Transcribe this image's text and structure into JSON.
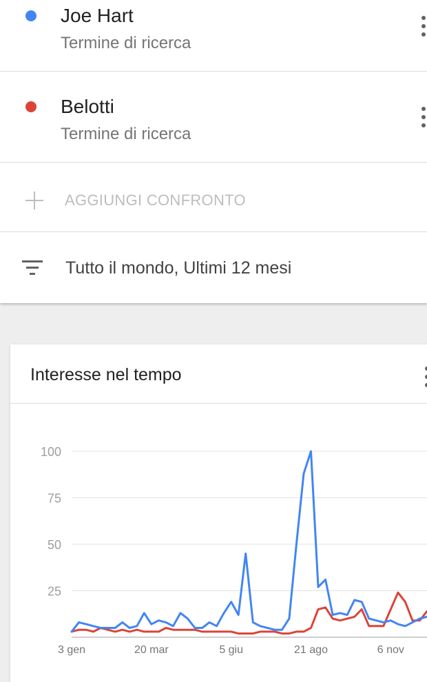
{
  "terms": [
    {
      "name": "Joe Hart",
      "type": "Termine di ricerca",
      "color": "#4285f4"
    },
    {
      "name": "Belotti",
      "type": "Termine di ricerca",
      "color": "#db4437"
    }
  ],
  "add_compare_label": "AGGIUNGI CONFRONTO",
  "filter_label": "Tutto il mondo, Ultimi 12 mesi",
  "icons": {
    "more": "more-vert-icon",
    "add": "plus-icon",
    "filter": "filter-list-icon"
  },
  "chart_section_title": "Interesse nel tempo",
  "chart_data": {
    "type": "line",
    "title": "Interesse nel tempo",
    "ylim": [
      0,
      100
    ],
    "yticks": [
      25,
      50,
      75,
      100
    ],
    "grid": true,
    "x_tick_labels": [
      "3 gen",
      "20 mar",
      "5 giu",
      "21 ago",
      "6 nov"
    ],
    "x_tick_index": [
      0,
      11,
      22,
      33,
      44
    ],
    "series": [
      {
        "name": "Joe Hart",
        "color": "#4285f4",
        "values": [
          3,
          8,
          7,
          6,
          5,
          5,
          5,
          8,
          5,
          6,
          13,
          7,
          9,
          8,
          6,
          13,
          10,
          5,
          5,
          8,
          6,
          13,
          19,
          12,
          45,
          8,
          6,
          5,
          4,
          4,
          10,
          50,
          88,
          100,
          27,
          31,
          12,
          13,
          12,
          20,
          19,
          10,
          9,
          8,
          9,
          7,
          6,
          8,
          10,
          11
        ]
      },
      {
        "name": "Belotti",
        "color": "#db4437",
        "values": [
          3,
          4,
          4,
          3,
          5,
          4,
          3,
          4,
          3,
          4,
          3,
          3,
          3,
          5,
          4,
          4,
          4,
          4,
          3,
          3,
          3,
          3,
          3,
          2,
          2,
          2,
          3,
          3,
          3,
          2,
          2,
          3,
          3,
          5,
          15,
          16,
          10,
          9,
          10,
          11,
          15,
          6,
          6,
          6,
          15,
          24,
          19,
          9,
          9,
          14
        ]
      }
    ]
  }
}
